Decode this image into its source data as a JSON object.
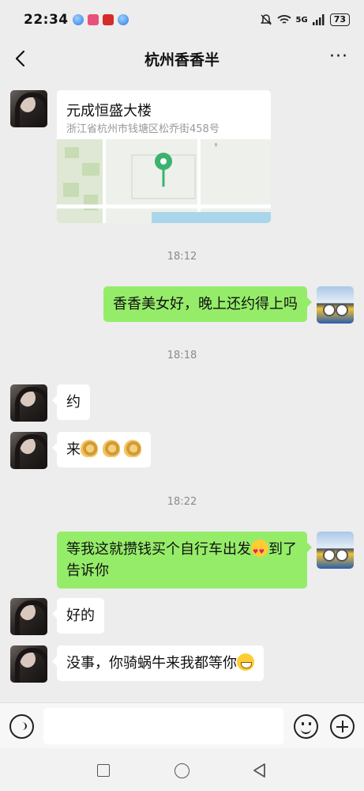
{
  "status_bar": {
    "time": "22:34",
    "network": "5G",
    "battery": "73"
  },
  "header": {
    "title": "杭州香香半"
  },
  "messages": {
    "location": {
      "name": "元成恒盛大楼",
      "address": "浙江省杭州市钱塘区松乔街458号"
    },
    "t1": "18:12",
    "m1": "香香美女好，晚上还约得上吗",
    "t2": "18:18",
    "m2": "约",
    "m3": "来",
    "t3": "18:22",
    "m4_a": "等我这就攒钱买个自行车出发",
    "m4_b": "到了告诉你",
    "m5": "好的",
    "m6": "没事，你骑蜗牛来我都等你"
  },
  "colors": {
    "sent_bubble": "#95ec69",
    "received_bubble": "#ffffff",
    "background": "#ededed"
  },
  "icons": {
    "header": [
      "back-arrow-icon",
      "more-dots-icon"
    ],
    "input": [
      "voice-icon",
      "emoji-icon",
      "plus-icon"
    ],
    "nav": [
      "recent-apps-icon",
      "home-icon",
      "back-icon"
    ]
  }
}
